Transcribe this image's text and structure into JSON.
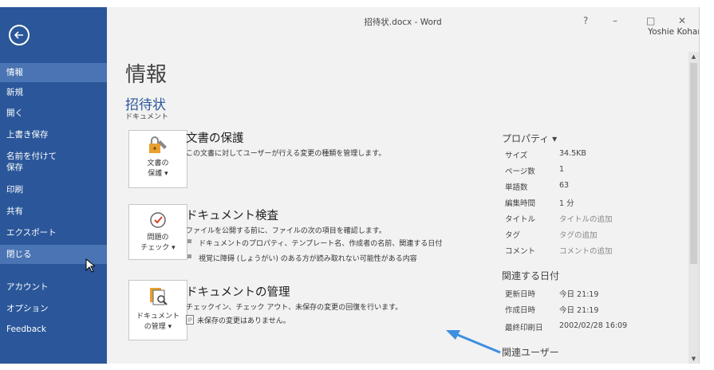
{
  "window": {
    "title": "招待状.docx - Word",
    "help": "?",
    "minimize": "–",
    "maximize": "□",
    "close": "✕",
    "user": "Yoshie Kohama"
  },
  "sidebar": {
    "items": [
      {
        "label": "情報"
      },
      {
        "label": "新規"
      },
      {
        "label": "開く"
      },
      {
        "label": "上書き保存"
      },
      {
        "label": "名前を付けて"
      },
      {
        "label": "保存"
      },
      {
        "label": "印刷"
      },
      {
        "label": "共有"
      },
      {
        "label": "エクスポート"
      },
      {
        "label": "閉じる"
      },
      {
        "label": "アカウント"
      },
      {
        "label": "オプション"
      },
      {
        "label": "Feedback"
      }
    ]
  },
  "main": {
    "title": "情報",
    "doc_name": "招待状",
    "doc_path": "ドキュメント",
    "sections": [
      {
        "tile": [
          "文書の",
          "保護 ▾"
        ],
        "title": "文書の保護",
        "desc": "この文書に対してユーザーが行える変更の種類を管理します。"
      },
      {
        "tile": [
          "問題の",
          "チェック ▾"
        ],
        "title": "ドキュメント検査",
        "desc": "ファイルを公開する前に、ファイルの次の項目を確認します。",
        "bullets": [
          "ドキュメントのプロパティ、テンプレート名、作成者の名前、関連する日付",
          "視覚に障碍 (しょうがい) のある方が読み取れない可能性がある内容"
        ]
      },
      {
        "tile": [
          "ドキュメント",
          "の管理 ▾"
        ],
        "title": "ドキュメントの管理",
        "desc": "チェックイン、チェック アウト、未保存の変更の回復を行います。",
        "note": "未保存の変更はありません。"
      }
    ]
  },
  "properties": {
    "header": "プロパティ ▾",
    "rows": [
      {
        "k": "サイズ",
        "v": "34.5KB"
      },
      {
        "k": "ページ数",
        "v": "1"
      },
      {
        "k": "単語数",
        "v": "63"
      },
      {
        "k": "編集時間",
        "v": "1 分"
      },
      {
        "k": "タイトル",
        "v": "タイトルの追加"
      },
      {
        "k": "タグ",
        "v": "タグの追加"
      },
      {
        "k": "コメント",
        "v": "コメントの追加"
      }
    ],
    "dates_header": "関連する日付",
    "dates": [
      {
        "k": "更新日時",
        "v": "今日 21:19"
      },
      {
        "k": "作成日時",
        "v": "今日 21:19"
      },
      {
        "k": "最終印刷日",
        "v": "2002/02/28 16:09"
      }
    ],
    "users_header": "関連ユーザー"
  },
  "colors": {
    "sidebar": "#2b579a",
    "sidebar_active": "#4a74b3",
    "accent": "#2b579a",
    "annotation_arrow": "#3d8fe0"
  }
}
